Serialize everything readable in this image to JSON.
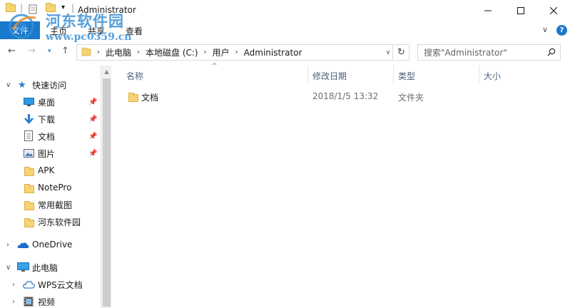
{
  "window": {
    "title": "Administrator",
    "minimize_icon": "minimize-icon",
    "maximize_icon": "maximize-icon",
    "close_icon": "close-icon"
  },
  "ribbon": {
    "file_tab": "文件",
    "tabs": [
      "主页",
      "共享",
      "查看"
    ],
    "help": "?"
  },
  "address": {
    "segments": [
      "此电脑",
      "本地磁盘 (C:)",
      "用户",
      "Administrator"
    ],
    "search_placeholder": "搜索\"Administrator\""
  },
  "sidebar": {
    "quick_access": "快速访问",
    "quick_items": [
      {
        "label": "桌面",
        "icon": "desktop-icon",
        "pinned": true
      },
      {
        "label": "下载",
        "icon": "download-icon",
        "pinned": true
      },
      {
        "label": "文档",
        "icon": "document-icon",
        "pinned": true
      },
      {
        "label": "图片",
        "icon": "picture-icon",
        "pinned": true
      },
      {
        "label": "APK",
        "icon": "folder-icon",
        "pinned": false
      },
      {
        "label": "NotePro",
        "icon": "folder-icon",
        "pinned": false
      },
      {
        "label": "常用截图",
        "icon": "folder-icon",
        "pinned": false
      },
      {
        "label": "河东软件园",
        "icon": "folder-icon",
        "pinned": false
      }
    ],
    "onedrive": "OneDrive",
    "this_pc": "此电脑",
    "pc_items": [
      {
        "label": "WPS云文档",
        "icon": "cloud-icon"
      },
      {
        "label": "视频",
        "icon": "video-icon"
      }
    ]
  },
  "columns": [
    "名称",
    "修改日期",
    "类型",
    "大小"
  ],
  "files": [
    {
      "name": "文档",
      "modified": "2018/1/5 13:32",
      "type": "文件夹",
      "size": ""
    }
  ],
  "watermark": {
    "name": "河东软件园",
    "url": "www.pc0359.cn"
  },
  "colors": {
    "accent": "#1979ca",
    "folder": "#f6d472",
    "header_text": "#4c607a"
  }
}
